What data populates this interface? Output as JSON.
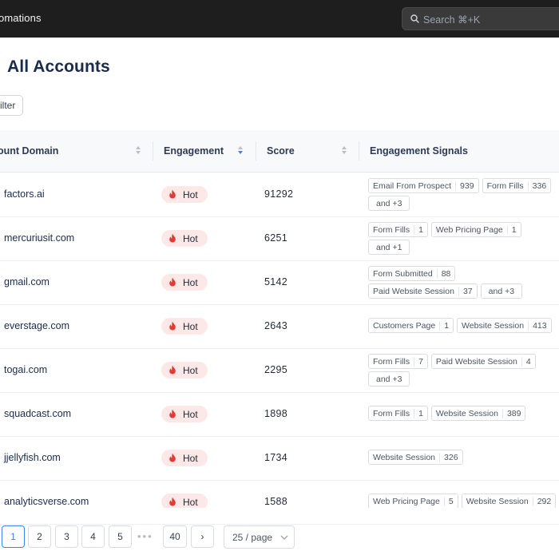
{
  "topbar": {
    "title": "omations",
    "search_placeholder": "Search ⌘+K",
    "search_icon": "search-icon"
  },
  "page": {
    "title": "All Accounts",
    "filter_label": "ilter"
  },
  "table": {
    "columns": [
      "ount Domain",
      "Engagement",
      "Score",
      "Engagement Signals"
    ],
    "sorted_column": "Engagement",
    "rows": [
      {
        "domain": "factors.ai",
        "engagement": "Hot",
        "score": "91292",
        "signals": [
          [
            {
              "name": "Email From Prospect",
              "count": "939"
            },
            {
              "name": "Form Fills",
              "count": "336"
            }
          ],
          [
            {
              "more": "and +3"
            }
          ]
        ]
      },
      {
        "domain": "mercuriusit.com",
        "engagement": "Hot",
        "score": "6251",
        "signals": [
          [
            {
              "name": "Form Fills",
              "count": "1"
            },
            {
              "name": "Web Pricing Page",
              "count": "1"
            }
          ],
          [
            {
              "more": "and +1"
            }
          ]
        ]
      },
      {
        "domain": "gmail.com",
        "engagement": "Hot",
        "score": "5142",
        "signals": [
          [
            {
              "name": "Form Submitted",
              "count": "88"
            }
          ],
          [
            {
              "name": "Paid Website Session",
              "count": "37"
            },
            {
              "more": "and +3"
            }
          ]
        ]
      },
      {
        "domain": "everstage.com",
        "engagement": "Hot",
        "score": "2643",
        "signals": [
          [
            {
              "name": "Customers Page",
              "count": "1"
            },
            {
              "name": "Website Session",
              "count": "413"
            }
          ]
        ]
      },
      {
        "domain": "togai.com",
        "engagement": "Hot",
        "score": "2295",
        "signals": [
          [
            {
              "name": "Form Fills",
              "count": "7"
            },
            {
              "name": "Paid Website Session",
              "count": "4"
            }
          ],
          [
            {
              "more": "and +3"
            }
          ]
        ]
      },
      {
        "domain": "squadcast.com",
        "engagement": "Hot",
        "score": "1898",
        "signals": [
          [
            {
              "name": "Form Fills",
              "count": "1"
            },
            {
              "name": "Website Session",
              "count": "389"
            }
          ]
        ]
      },
      {
        "domain": "jjellyfish.com",
        "engagement": "Hot",
        "score": "1734",
        "signals": [
          [
            {
              "name": "Website Session",
              "count": "326"
            }
          ]
        ]
      },
      {
        "domain": "analyticsverse.com",
        "engagement": "Hot",
        "score": "1588",
        "signals": [
          [
            {
              "name": "Web Pricing Page",
              "count": "5"
            },
            {
              "name": "Website Session",
              "count": "292"
            }
          ]
        ]
      }
    ]
  },
  "pagination": {
    "pages": [
      "1",
      "2",
      "3",
      "4",
      "5"
    ],
    "current": "1",
    "ellipsis": "•••",
    "last": "40",
    "next": "›",
    "page_size": "25 / page"
  },
  "colors": {
    "topbar_bg": "#1e1e1e",
    "accent": "#3b82f6",
    "hot_bg": "#fde8e8",
    "hot_flame": "#e53935",
    "title": "#1a2b4c"
  }
}
